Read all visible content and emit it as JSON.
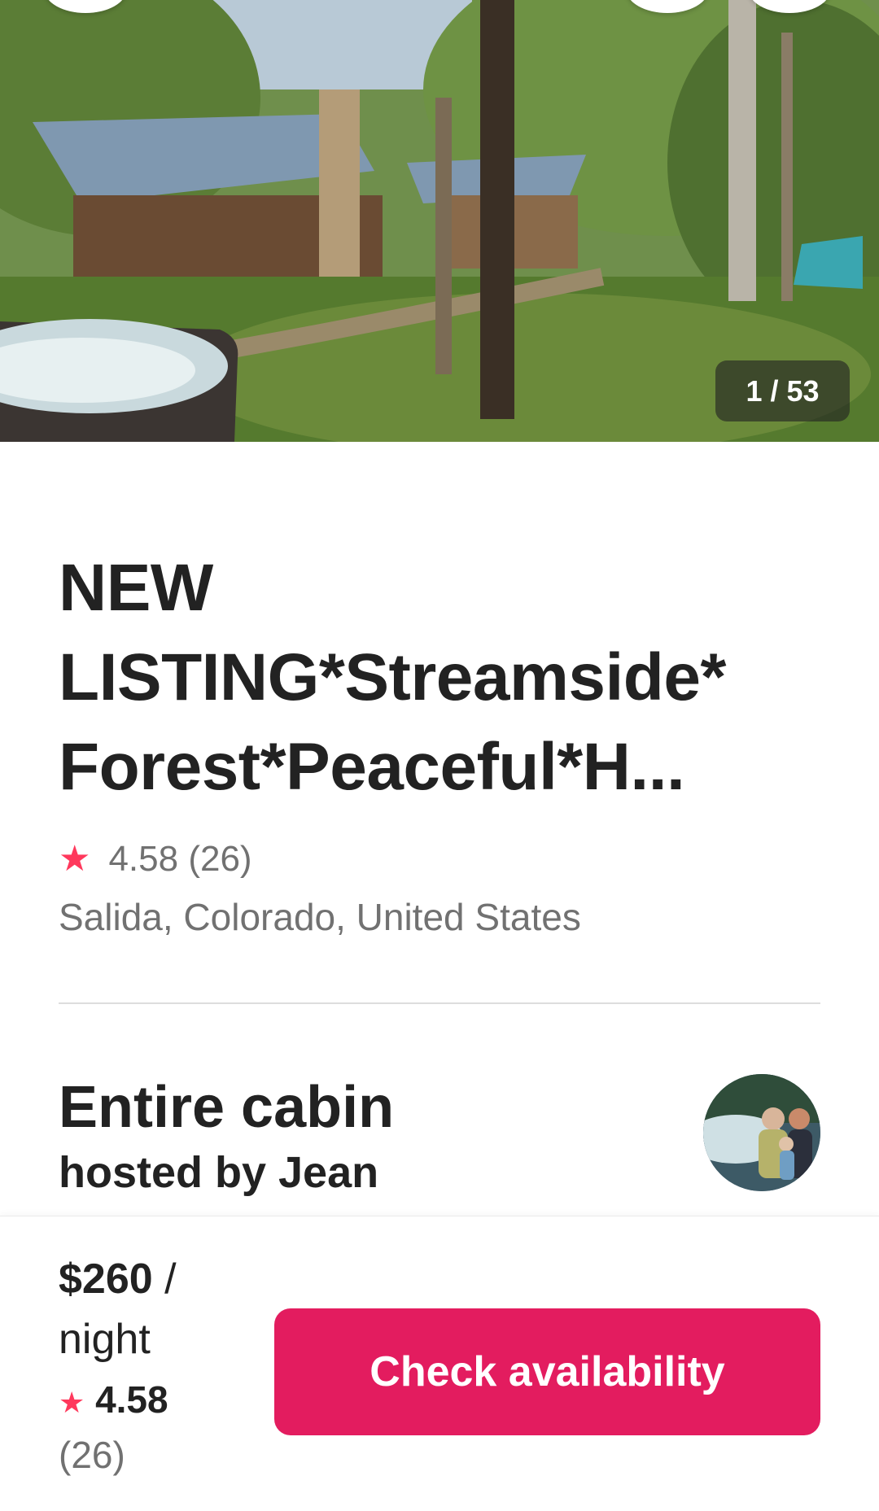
{
  "hero": {
    "photo_counter": "1 / 53"
  },
  "listing": {
    "title": "NEW LISTING*Streamside* Forest*Peaceful*H...",
    "rating": "4.58",
    "review_count": "(26)",
    "location": "Salida, Colorado, United States",
    "type_title": "Entire cabin",
    "host_line": "hosted by Jean"
  },
  "booking": {
    "price": "$260",
    "price_unit": " / night",
    "rating": "4.58",
    "review_count": "(26)",
    "check_button_label": "Check availability"
  },
  "icons": {
    "rating_star": "★",
    "star_color": "#ff385c",
    "button_color": "#e31c5f"
  }
}
